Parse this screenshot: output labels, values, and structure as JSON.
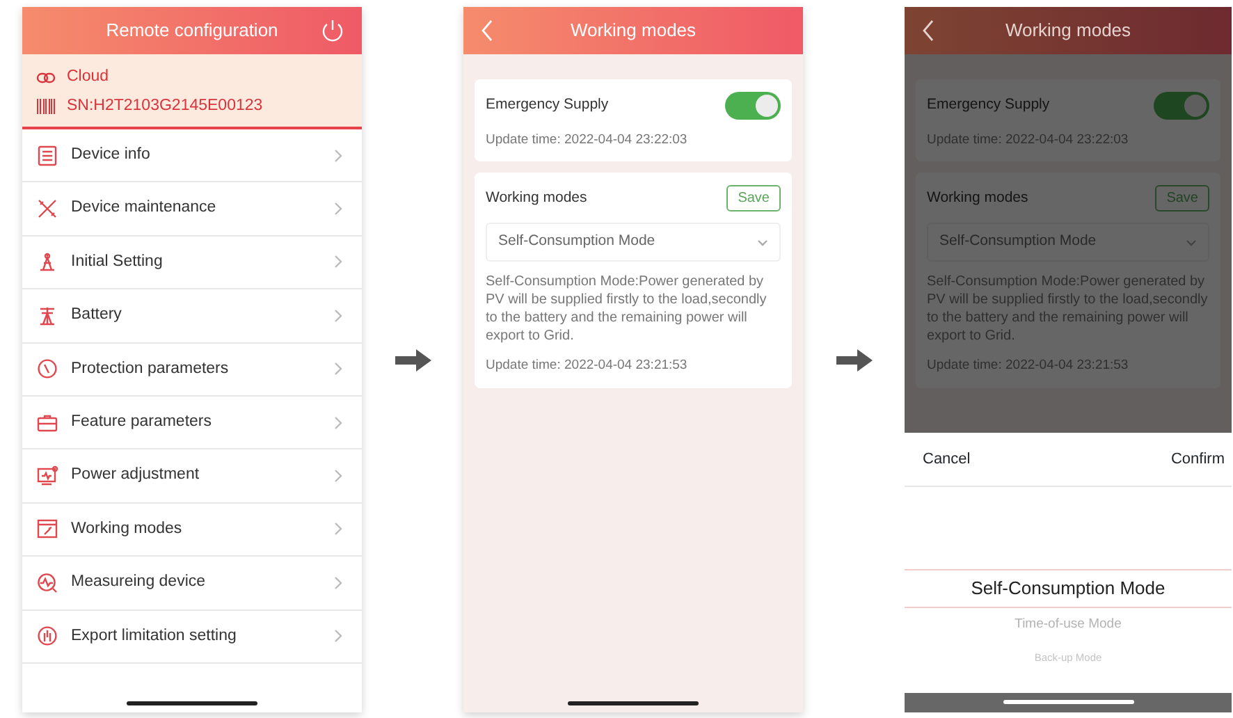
{
  "screens": [
    {
      "kind": "menu",
      "title": "Remote configuration",
      "connection": "Cloud",
      "serial": "SN:H2T2103G2145E00123",
      "items": [
        {
          "label": "Device info"
        },
        {
          "label": "Device maintenance"
        },
        {
          "label": "Initial Setting"
        },
        {
          "label": "Battery"
        },
        {
          "label": "Protection parameters"
        },
        {
          "label": "Feature parameters"
        },
        {
          "label": "Power adjustment"
        },
        {
          "label": "Working modes"
        },
        {
          "label": "Measureing device"
        },
        {
          "label": "Export limitation setting"
        }
      ]
    },
    {
      "kind": "modes",
      "title": "Working modes",
      "emergency": {
        "label": "Emergency Supply",
        "on": true,
        "update": "Update time: 2022-04-04 23:22:03"
      },
      "modes": {
        "label": "Working modes",
        "save": "Save",
        "value": "Self-Consumption Mode",
        "description": "Self-Consumption Mode:Power generated by PV will be supplied firstly to the load,secondly to the battery and the remaining power will export to Grid.",
        "update": "Update time: 2022-04-04 23:21:53"
      }
    },
    {
      "kind": "modes",
      "title": "Working modes",
      "emergency": {
        "label": "Emergency Supply",
        "on": true,
        "update": "Update time: 2022-04-04 23:22:03"
      },
      "modes": {
        "label": "Working modes",
        "save": "Save",
        "value": "Self-Consumption Mode",
        "description": "Self-Consumption Mode:Power generated by PV will be supplied firstly to the load,secondly to the battery and the remaining power will export to Grid.",
        "update": "Update time: 2022-04-04 23:21:53"
      },
      "picker": {
        "cancel": "Cancel",
        "confirm": "Confirm",
        "options": [
          {
            "label": "Self-Consumption Mode",
            "selected": true
          },
          {
            "label": "Time-of-use Mode",
            "selected": false
          },
          {
            "label": "Back-up Mode",
            "selected": false
          }
        ]
      }
    }
  ]
}
